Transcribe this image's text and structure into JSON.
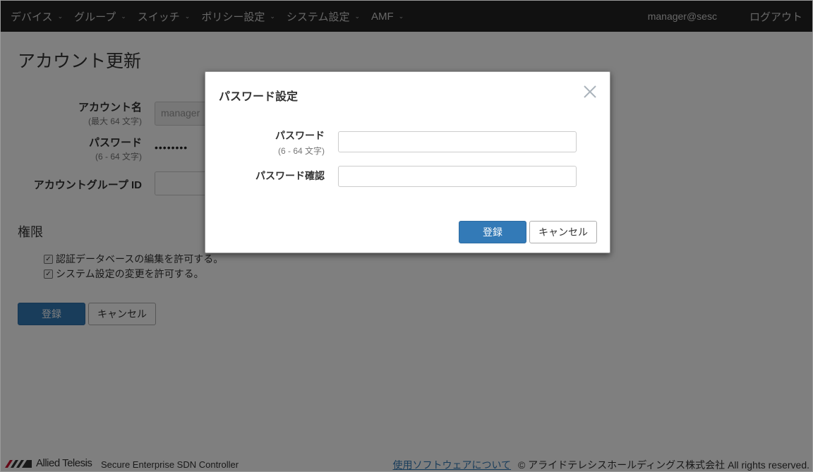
{
  "navbar": {
    "items": [
      {
        "label": "デバイス"
      },
      {
        "label": "グループ"
      },
      {
        "label": "スイッチ"
      },
      {
        "label": "ポリシー設定"
      },
      {
        "label": "システム設定"
      },
      {
        "label": "AMF"
      }
    ],
    "caret": "⌄",
    "user": "manager@sesc",
    "logout": "ログアウト"
  },
  "page": {
    "title": "アカウント更新",
    "account_name": {
      "label": "アカウント名",
      "hint": "(最大 64 文字)",
      "value": "manager"
    },
    "password": {
      "label": "パスワード",
      "hint": "(6 - 64 文字)",
      "value": "••••••••"
    },
    "group_id": {
      "label": "アカウントグループ ID",
      "value": ""
    },
    "permissions": {
      "title": "権限",
      "items": [
        {
          "label": "認証データベースの編集を許可する。",
          "checked": true
        },
        {
          "label": "システム設定の変更を許可する。",
          "checked": true
        }
      ]
    },
    "submit": "登録",
    "cancel": "キャンセル"
  },
  "footer": {
    "logo_text": "Allied Telesis",
    "product": "Secure Enterprise SDN Controller",
    "link": "使用ソフトウェアについて",
    "copyright": "© アライドテレシスホールディングス株式会社 All rights reserved."
  },
  "modal": {
    "title": "パスワード設定",
    "password": {
      "label": "パスワード",
      "hint": "(6 - 64 文字)",
      "value": ""
    },
    "confirm": {
      "label": "パスワード確認",
      "value": ""
    },
    "submit": "登録",
    "cancel": "キャンセル"
  },
  "colors": {
    "navbar": "#222222",
    "primary": "#337ab7",
    "logo_red": "#c8102e"
  }
}
